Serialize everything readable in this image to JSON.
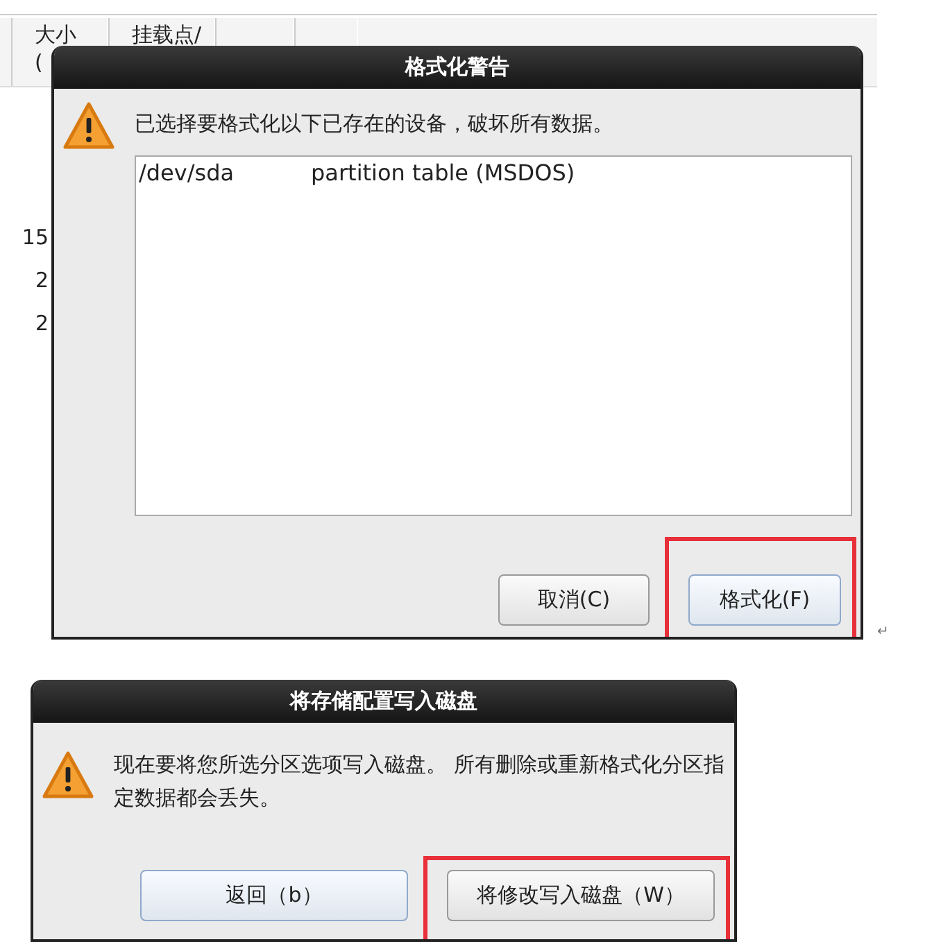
{
  "background_table": {
    "columns": [
      {
        "label": "大小",
        "sublabel": "("
      },
      {
        "label": "挂载点/"
      }
    ],
    "rows": [
      "15",
      "2",
      "2"
    ]
  },
  "dialogs": [
    {
      "title": "格式化警告",
      "message": "已选择要格式化以下已存在的设备，破坏所有数据。",
      "devices": [
        {
          "device": "/dev/sda",
          "description": "partition table (MSDOS)"
        }
      ],
      "buttons": [
        {
          "label": "取消(C)",
          "focused": false,
          "highlighted": false
        },
        {
          "label": "格式化(F)",
          "focused": true,
          "highlighted": true
        }
      ]
    },
    {
      "title": "将存储配置写入磁盘",
      "message": "现在要将您所选分区选项写入磁盘。 所有删除或重新格式化分区指定数据都会丢失。",
      "buttons": [
        {
          "label": "返回（b）",
          "focused": true,
          "highlighted": false
        },
        {
          "label": "将修改写入磁盘（W）",
          "focused": false,
          "highlighted": true
        }
      ]
    }
  ],
  "paragraph_mark": "↵"
}
